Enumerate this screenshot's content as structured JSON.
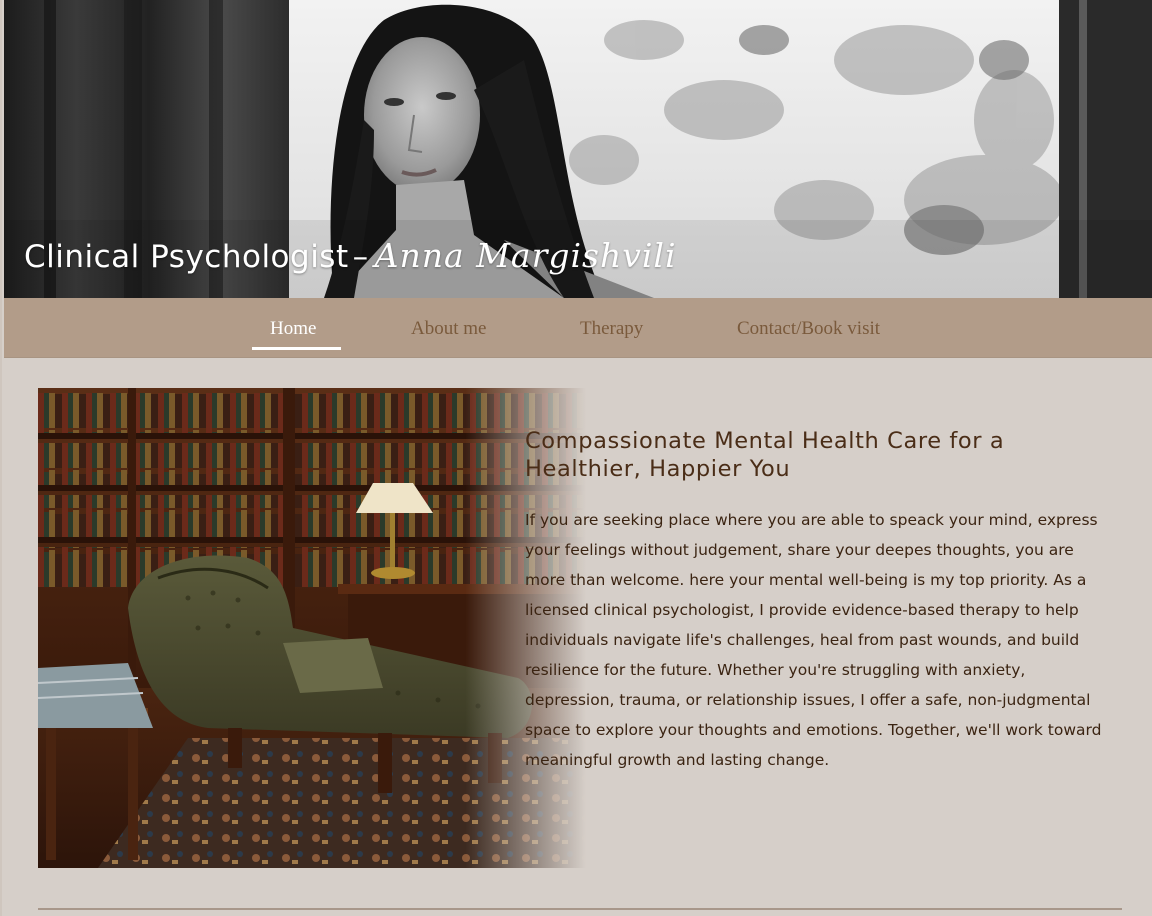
{
  "hero": {
    "title": "Clinical Psychologist",
    "dash": "–",
    "name": "Anna Margishvili"
  },
  "nav": {
    "items": [
      {
        "label": "Home",
        "active": true
      },
      {
        "label": "About me",
        "active": false
      },
      {
        "label": "Therapy",
        "active": false
      },
      {
        "label": "Contact/Book visit",
        "active": false
      }
    ]
  },
  "main": {
    "headline": "Compassionate Mental Health Care for a Healthier, Happier You",
    "body": "If you are seeking place where you are able to speack your mind, express your feelings without judgement, share your deepes thoughts, you are more than welcome. here your mental well-being is my top priority. As a licensed clinical psychologist, I provide evidence-based therapy to help individuals navigate life's challenges, heal from past wounds, and build resilience for the future. Whether you're struggling with anxiety, depression, trauma, or relationship issues, I offer a safe, non-judgmental space to explore your thoughts and emotions. Together, we'll work toward meaningful growth and lasting change."
  },
  "colors": {
    "nav_bg": "#b29c89",
    "page_bg": "#d6cfc9",
    "nav_text": "#7a5a3c",
    "headline_text": "#4a2d17",
    "body_text": "#3b2412"
  }
}
